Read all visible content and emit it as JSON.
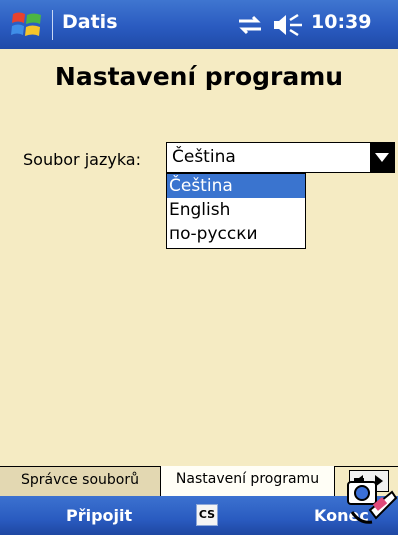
{
  "titlebar": {
    "app_title": "Datis",
    "clock": "10:39",
    "icons": [
      "windows-start-icon",
      "connectivity-icon",
      "volume-icon"
    ]
  },
  "main": {
    "heading": "Nastavení programu",
    "language_label": "Soubor jazyka:",
    "language_select": {
      "value": "Čeština",
      "options": [
        "Čeština",
        "English",
        "по-русски"
      ],
      "selected_index": 0
    }
  },
  "tabs": [
    {
      "label": "Správce souborů",
      "active": false
    },
    {
      "label": "Nastavení programu",
      "active": true
    }
  ],
  "menubar": {
    "left_softkey": "Připojit",
    "input_indicator": "CS",
    "right_softkey": "Konec"
  },
  "colors": {
    "background": "#f5ebc3",
    "bar_blue": "#2a5bc0",
    "selection": "#3a74cf"
  }
}
